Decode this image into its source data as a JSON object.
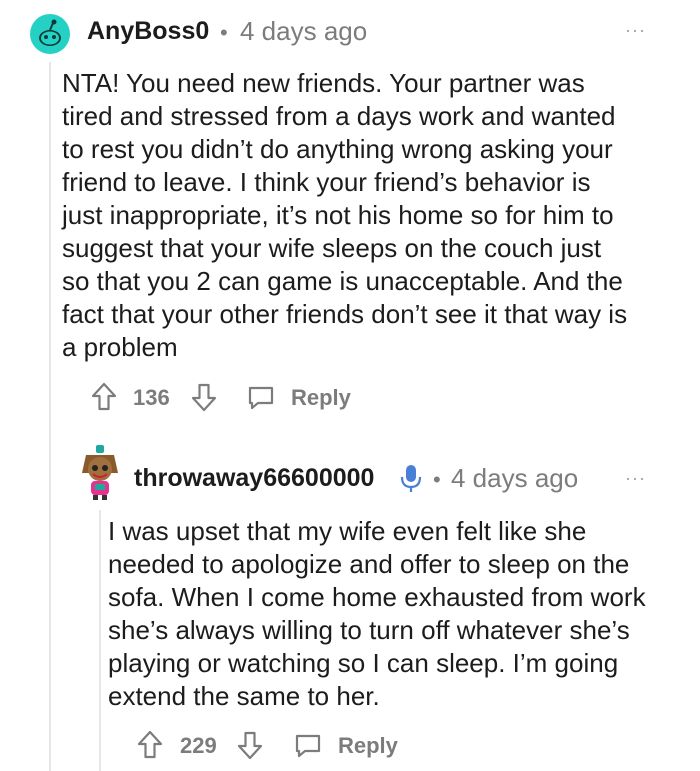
{
  "comments": [
    {
      "username": "AnyBoss0",
      "separator": "•",
      "time": "4 days ago",
      "more": "···",
      "body": "NTA! You need new friends. Your partner was tired and stressed from a days work and wanted to rest you didn’t do anything wrong asking your friend to leave. I think your friend’s behavior is just inappropriate, it’s not his home so for him to suggest that your wife sleeps on the couch just so that you 2 can game is unacceptable. And the fact that your other friends don’t see it that way is a problem",
      "votes": "136",
      "reply_label": "Reply",
      "avatar_color": "#24d1c4"
    },
    {
      "username": "throwaway66600000",
      "separator": "•",
      "time": "4 days ago",
      "more": "···",
      "body": "I was upset that my wife even felt like she needed to apologize and offer to sleep on the sofa. When I come home exhausted from work she’s always willing to turn off whatever she’s playing or watching so I can sleep. I’m going extend the same to her.",
      "votes": "229",
      "reply_label": "Reply",
      "badge_color": "#4a7fd8"
    }
  ]
}
